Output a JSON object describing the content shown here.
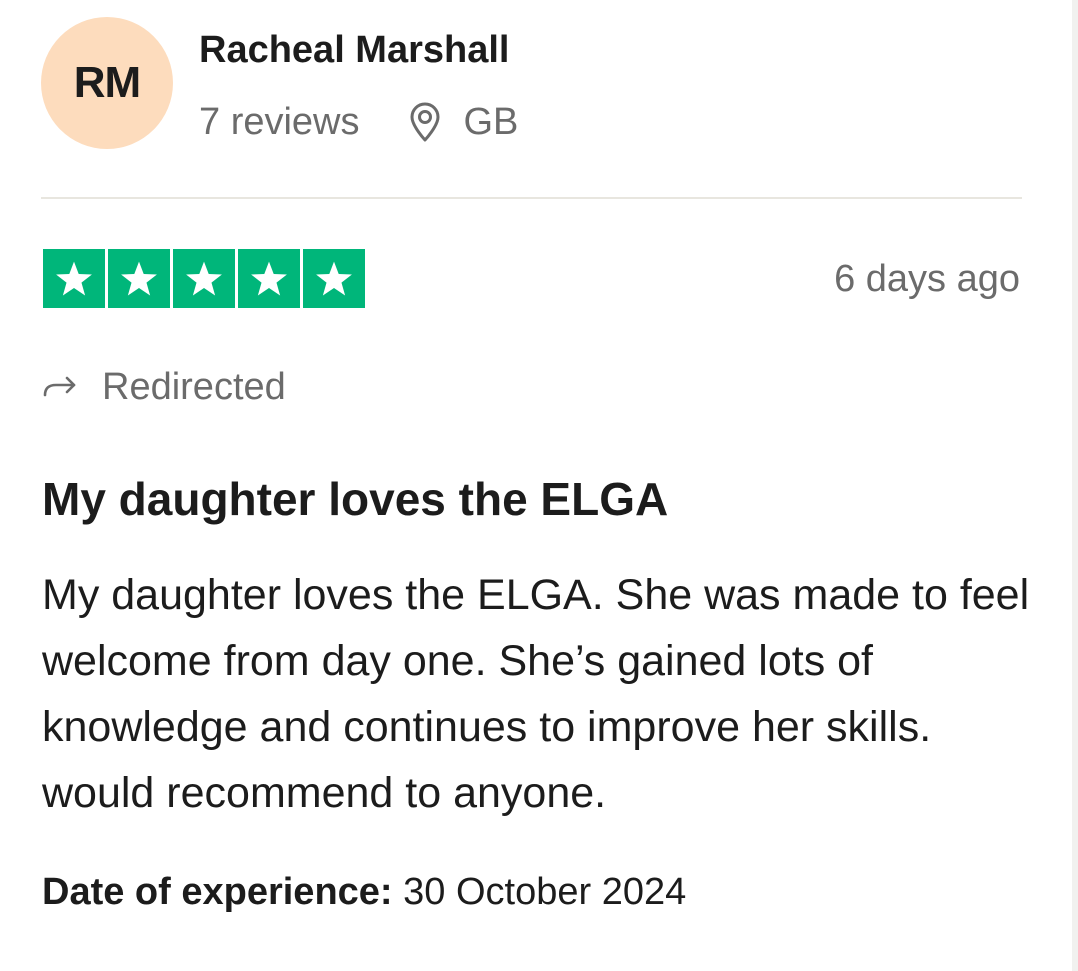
{
  "reviewer": {
    "initials": "RM",
    "name": "Racheal Marshall",
    "review_count": "7 reviews",
    "location": "GB",
    "avatar_color": "#fddcbd"
  },
  "review": {
    "rating": 5,
    "rating_max": 5,
    "star_color": "#00b67a",
    "date_ago": "6 days ago",
    "redirect_label": "Redirected",
    "title": "My daughter loves the ELGA",
    "body": "My daughter loves the ELGA. She was made to feel welcome from day one. She’s gained lots of knowledge and continues to improve her skills. would recommend to anyone.",
    "experience_label": "Date of experience:",
    "experience_date": "30 October 2024"
  },
  "icons": {
    "location": "map-pin-icon",
    "redirect": "redirect-arrow-icon",
    "star": "star-icon"
  }
}
